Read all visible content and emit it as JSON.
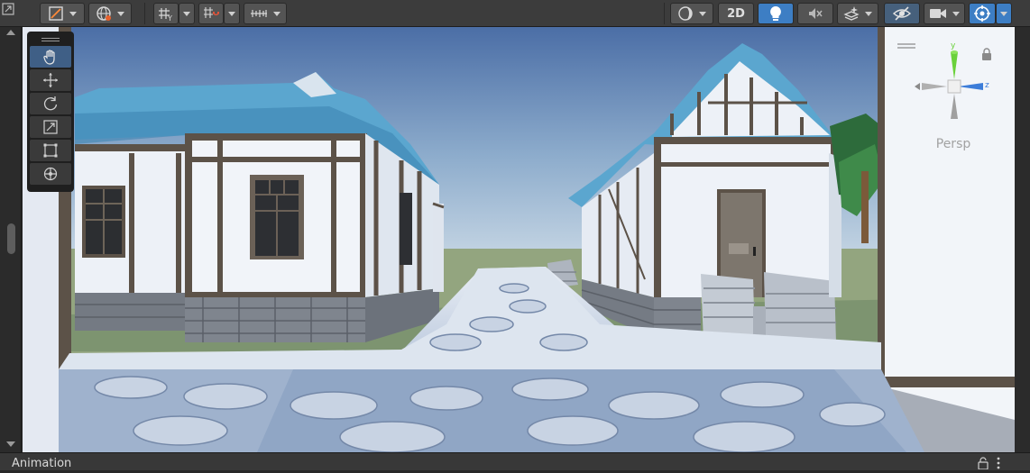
{
  "toolbar": {
    "buttons": [
      {
        "name": "tool-handle-button",
        "icon": "square-pivot-icon"
      },
      {
        "name": "global-local-button",
        "icon": "globe-icon"
      },
      {
        "name": "grid-snap-button",
        "icon": "grid-snapping-icon"
      },
      {
        "name": "incremental-snap-button",
        "icon": "magnet-snap-icon"
      },
      {
        "name": "ruler-button",
        "icon": "ruler-icon"
      },
      {
        "name": "draw-mode-button",
        "icon": "shaded-sphere-icon"
      },
      {
        "name": "lighting-toggle",
        "icon": "lightbulb-icon",
        "state": "on"
      },
      {
        "name": "audio-toggle",
        "icon": "speaker-mute-icon"
      },
      {
        "name": "effects-button",
        "icon": "effects-icon"
      },
      {
        "name": "scene-visibility-toggle",
        "icon": "eye-slash-icon",
        "state": "active"
      },
      {
        "name": "camera-button",
        "icon": "camera-icon"
      },
      {
        "name": "gizmos-button",
        "icon": "gizmos-icon",
        "state": "on"
      }
    ],
    "label_2d": "2D"
  },
  "tools": [
    "hand-tool-icon",
    "move-tool-icon",
    "rotate-tool-icon",
    "scale-tool-icon",
    "rect-tool-icon",
    "transform-tool-icon"
  ],
  "gizmo": {
    "y_label": "y",
    "z_label": "z",
    "projection": "Persp",
    "colors": {
      "y": "#6ad13b",
      "z": "#3c7dd9",
      "x": "#9a9a9a"
    }
  },
  "statusbar": {
    "title": "Animation"
  },
  "scene": {
    "sky_top": "#4a6fa8",
    "sky_bottom": "#b9cde0",
    "roof_color": "#5aa8d2",
    "wall_color": "#eef2f8",
    "timber_color": "#5c5248",
    "grass_color": "#8fa27a"
  }
}
